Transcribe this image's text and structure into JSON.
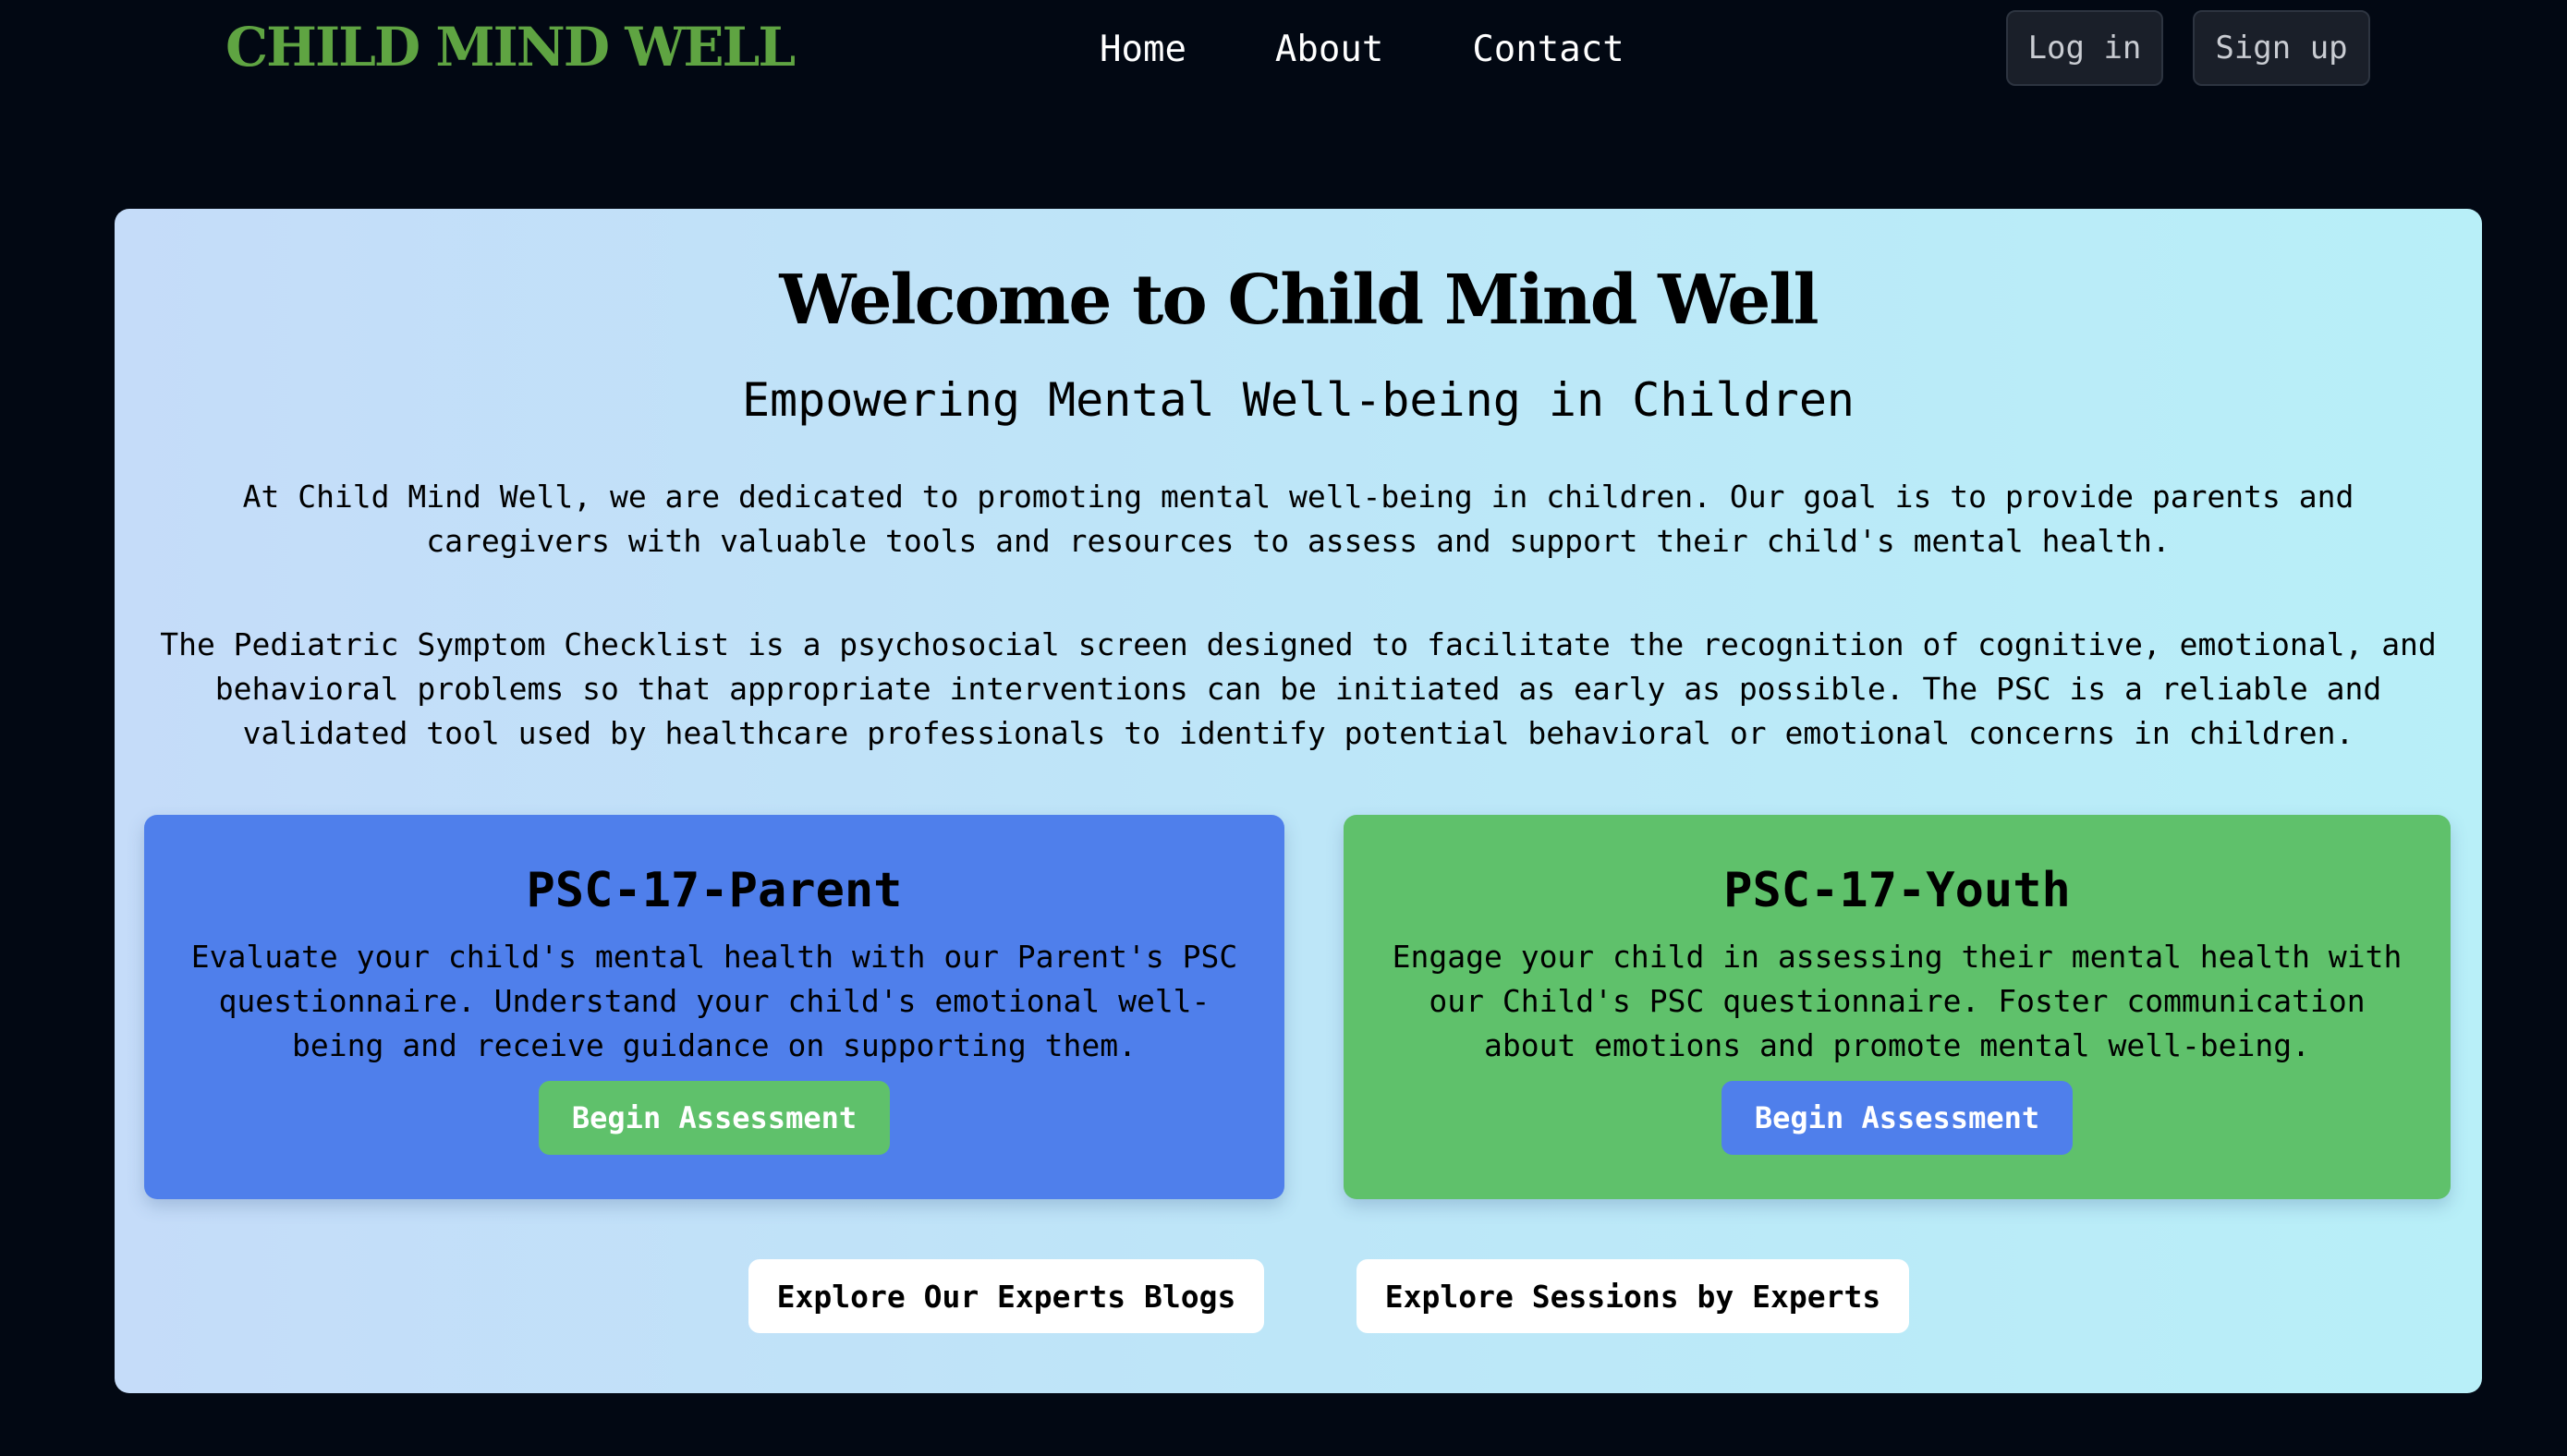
{
  "header": {
    "logo": "CHILD MIND WELL",
    "nav": {
      "home": "Home",
      "about": "About",
      "contact": "Contact"
    },
    "login_label": "Log in",
    "signup_label": "Sign up"
  },
  "hero": {
    "title": "Welcome to Child Mind Well",
    "subtitle": "Empowering Mental Well-being in Children",
    "intro": "At Child Mind Well, we are dedicated to promoting mental well-being in children. Our goal is to provide parents and caregivers with valuable tools and resources to assess and support their child's mental health.",
    "psc_description": "The Pediatric Symptom Checklist is a psychosocial screen designed to facilitate the recognition of cognitive, emotional, and behavioral problems so that appropriate interventions can be initiated as early as possible. The PSC is a reliable and validated tool used by healthcare professionals to identify potential behavioral or emotional concerns in children."
  },
  "cards": [
    {
      "title": "PSC-17-Parent",
      "text": "Evaluate your child's mental health with our Parent's PSC questionnaire. Understand your child's emotional well-being and receive guidance on supporting them.",
      "button": "Begin Assessment"
    },
    {
      "title": "PSC-17-Youth",
      "text": "Engage your child in assessing their mental health with our Child's PSC questionnaire. Foster communication about emotions and promote mental well-being.",
      "button": "Begin Assessment"
    }
  ],
  "explore": {
    "blogs": "Explore Our Experts Blogs",
    "sessions": "Explore Sessions by Experts"
  },
  "colors": {
    "page_background": "#020813",
    "logo": "#5fa442",
    "card_blue": "#4f7feb",
    "card_green": "#5fc16b",
    "hero_gradient_start": "#c5dcf9",
    "hero_gradient_end": "#b8eff8"
  }
}
